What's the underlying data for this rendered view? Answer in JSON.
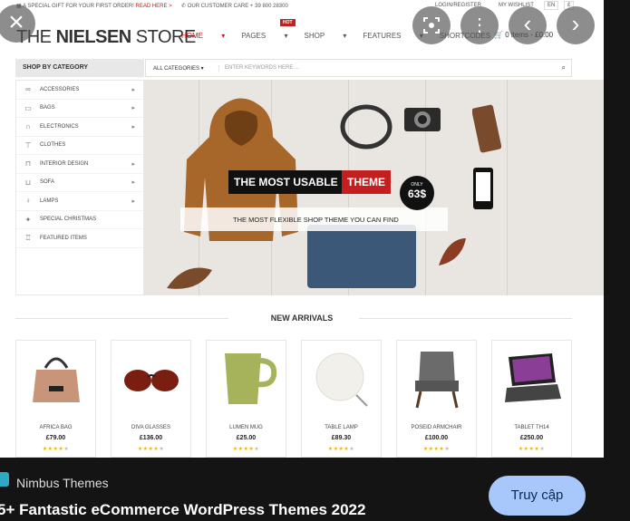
{
  "topbar": {
    "gift_text": "A SPECIAL GIFT FOR YOUR FIRST ORDER!",
    "gift_link": "READ HERE >",
    "care": "OUR CUSTOMER CARE + 39 800 28300",
    "login": "LOGIN/REGISTER",
    "wishlist": "MY WISHLIST",
    "lang1": "EN",
    "lang2": "£"
  },
  "header": {
    "logo_pre": "THE ",
    "logo_bold": "NIELSEN",
    "logo_post": " STORE",
    "nav": [
      "HOME",
      "PAGES",
      "SHOP",
      "FEATURES",
      "SHORTCODES"
    ],
    "hot_badge": "HOT",
    "cart": "0 items - £0.00"
  },
  "search": {
    "category_title": "SHOP BY CATEGORY",
    "all_categories": "ALL CATEGORIES",
    "placeholder": "ENTER KEYWORDS HERE ..."
  },
  "sidebar": {
    "items": [
      {
        "label": "ACCESSORIES",
        "icon": "glasses-icon",
        "arrow": true
      },
      {
        "label": "BAGS",
        "icon": "bag-icon",
        "arrow": true
      },
      {
        "label": "ELECTRONICS",
        "icon": "headphones-icon",
        "arrow": true
      },
      {
        "label": "CLOTHES",
        "icon": "shirt-icon",
        "arrow": false
      },
      {
        "label": "INTERIOR DESIGN",
        "icon": "interior-icon",
        "arrow": true
      },
      {
        "label": "SOFA",
        "icon": "sofa-icon",
        "arrow": true
      },
      {
        "label": "LAMPS",
        "icon": "lamp-icon",
        "arrow": true
      },
      {
        "label": "SPECIAL CHRISTMAS",
        "icon": "gift-icon",
        "arrow": false
      },
      {
        "label": "FEATURED ITEMS",
        "icon": "trophy-icon",
        "arrow": false
      }
    ]
  },
  "hero": {
    "title": "THE MOST USABLE",
    "title_accent": "THEME",
    "only": "ONLY",
    "price": "63$",
    "subtitle": "THE MOST FLEXIBLE SHOP THEME YOU CAN FIND"
  },
  "arrivals": {
    "title": "NEW ARRIVALS",
    "products": [
      {
        "name": "AFRICA BAG",
        "price": "£79.00",
        "stars": "★★★★",
        "empty": "★"
      },
      {
        "name": "DIVA GLASSES",
        "price": "£136.00",
        "stars": "★★★★",
        "empty": "★"
      },
      {
        "name": "LUMEN MUG",
        "price": "£25.00",
        "stars": "★★★★",
        "empty": "★"
      },
      {
        "name": "TABLE LAMP",
        "price": "£89.30",
        "stars": "★★★★",
        "empty": "★"
      },
      {
        "name": "POSEID ARMCHAIR",
        "price": "£100.00",
        "stars": "★★★★",
        "empty": "★"
      },
      {
        "name": "TABLET TH14",
        "price": "£250.00",
        "stars": "★★★★",
        "empty": "★"
      }
    ]
  },
  "viewer": {
    "source": "Nimbus Themes",
    "caption": "5+ Fantastic eCommerce WordPress Themes 2022",
    "visit": "Truy cập",
    "close_icon": "×",
    "more_icon": "⋮",
    "prev_icon": "‹",
    "next_icon": "›",
    "accent": "#a8c7fa"
  }
}
